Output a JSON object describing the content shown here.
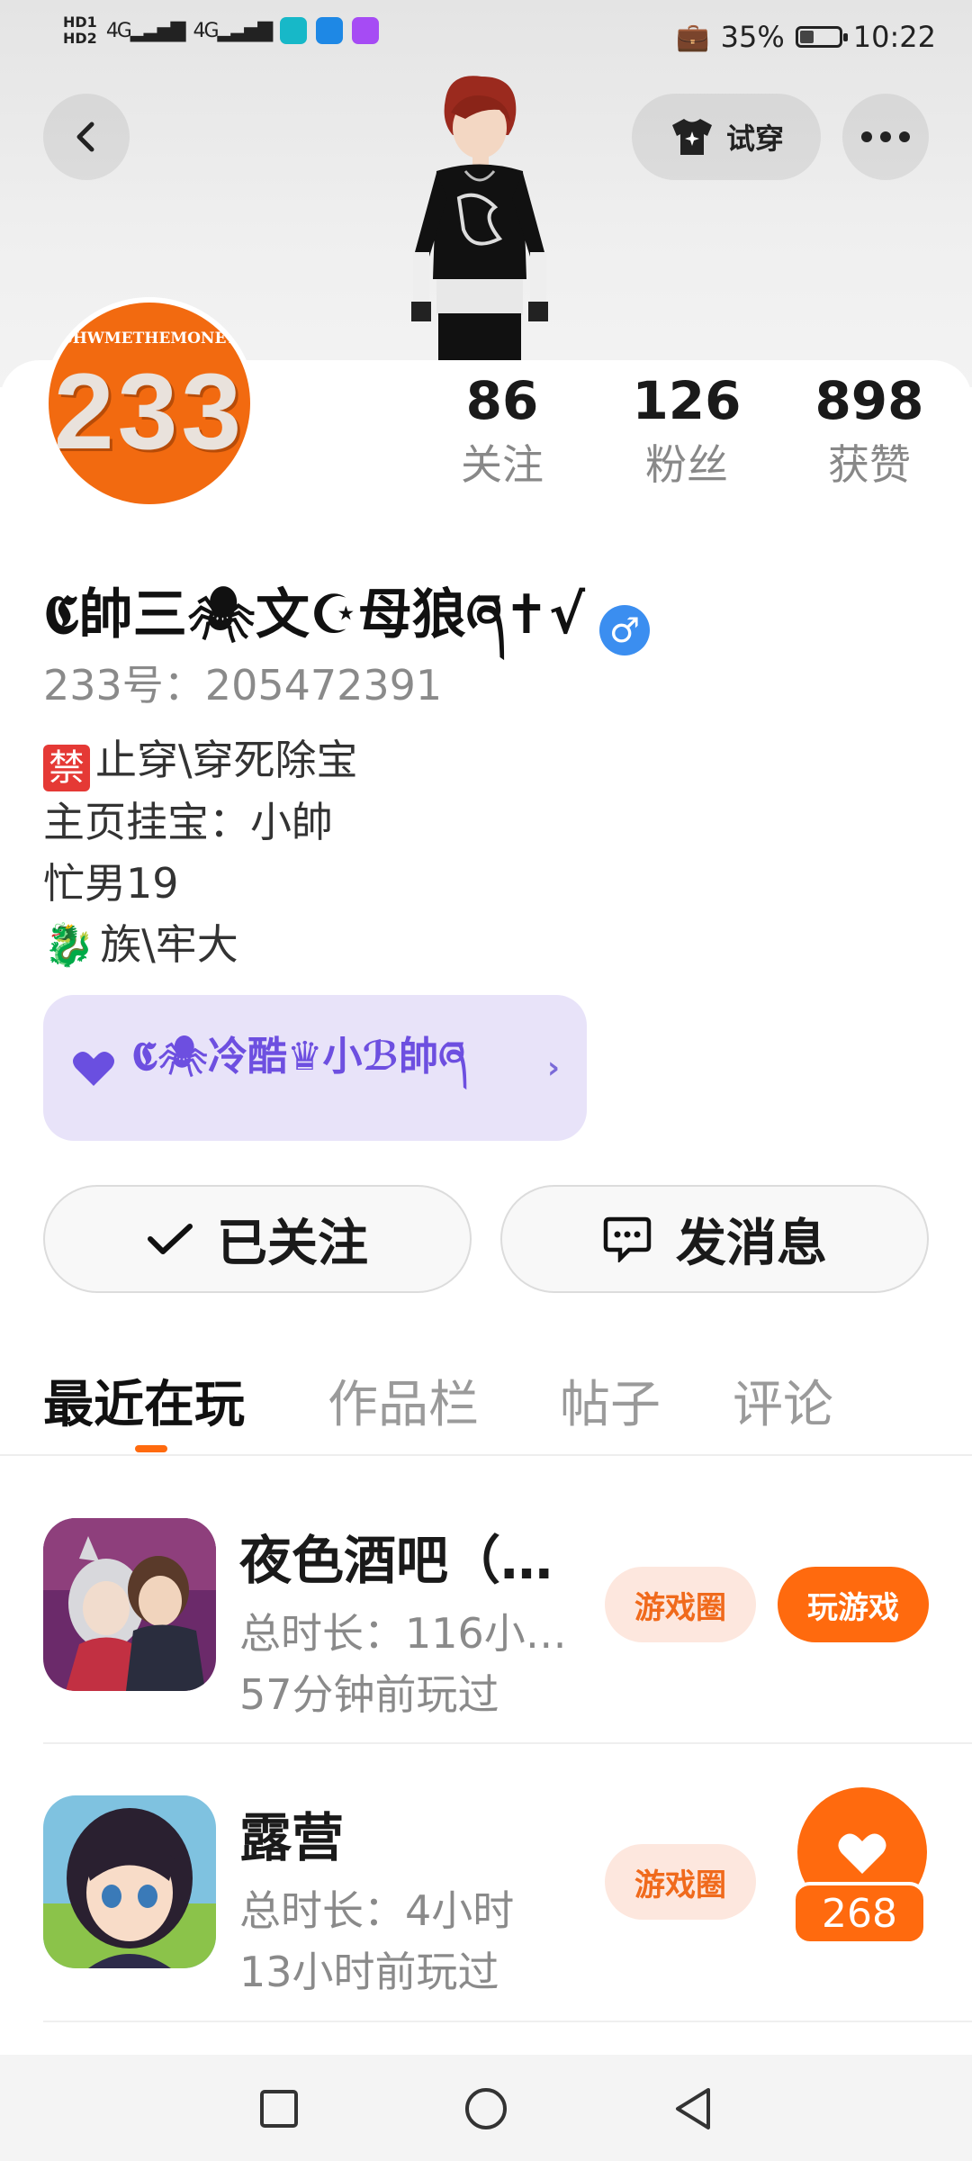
{
  "status_bar": {
    "hd1": "HD1",
    "hd2": "HD2",
    "signal1": "4G",
    "signal2": "4G",
    "battery_pct": "35%",
    "battery_level": 0.35,
    "time": "10:22"
  },
  "header": {
    "back_icon": "chevron-left-icon",
    "try_on_label": "试穿",
    "try_on_icon": "tshirt-sparkle-icon",
    "more_icon": "more-dots-icon"
  },
  "profile": {
    "avatar_top_text": "SHWMETHEMONEY",
    "avatar_main_text": "233",
    "stats": [
      {
        "value": "86",
        "label": "关注"
      },
      {
        "value": "126",
        "label": "粉丝"
      },
      {
        "value": "898",
        "label": "获赞"
      }
    ],
    "nickname": "𝕮帥三🕷文☪母狼ཞ✝√",
    "gender_symbol": "♂",
    "uid": "233号：205472391",
    "bio_lines": [
      "止穿\\穿死除宝",
      "主页挂宝：小帥",
      "忙男19",
      "族\\牢大"
    ],
    "bio_ban_badge": "禁",
    "bio_dragon": "🐉",
    "fan_card_text": "𝕮🕷冷酷♛小ℬ帥ཞ"
  },
  "actions": {
    "follow_label": "已关注",
    "message_label": "发消息"
  },
  "tabs": [
    "最近在玩",
    "作品栏",
    "帖子",
    "评论"
  ],
  "games": [
    {
      "title": "夜色酒吧（…",
      "duration": "总时长：116小…",
      "last_played": "57分钟前玩过",
      "circle_label": "游戏圈",
      "play_label": "玩游戏"
    },
    {
      "title": "露营",
      "duration": "总时长：4小时",
      "last_played": "13小时前玩过",
      "circle_label": "游戏圈"
    }
  ],
  "like": {
    "count": "268"
  },
  "colors": {
    "accent": "#ff6a0e",
    "gender_blue": "#3b8ef0",
    "fan_card_bg": "#e8e3f9",
    "fan_card_text": "#6d4fe0"
  }
}
